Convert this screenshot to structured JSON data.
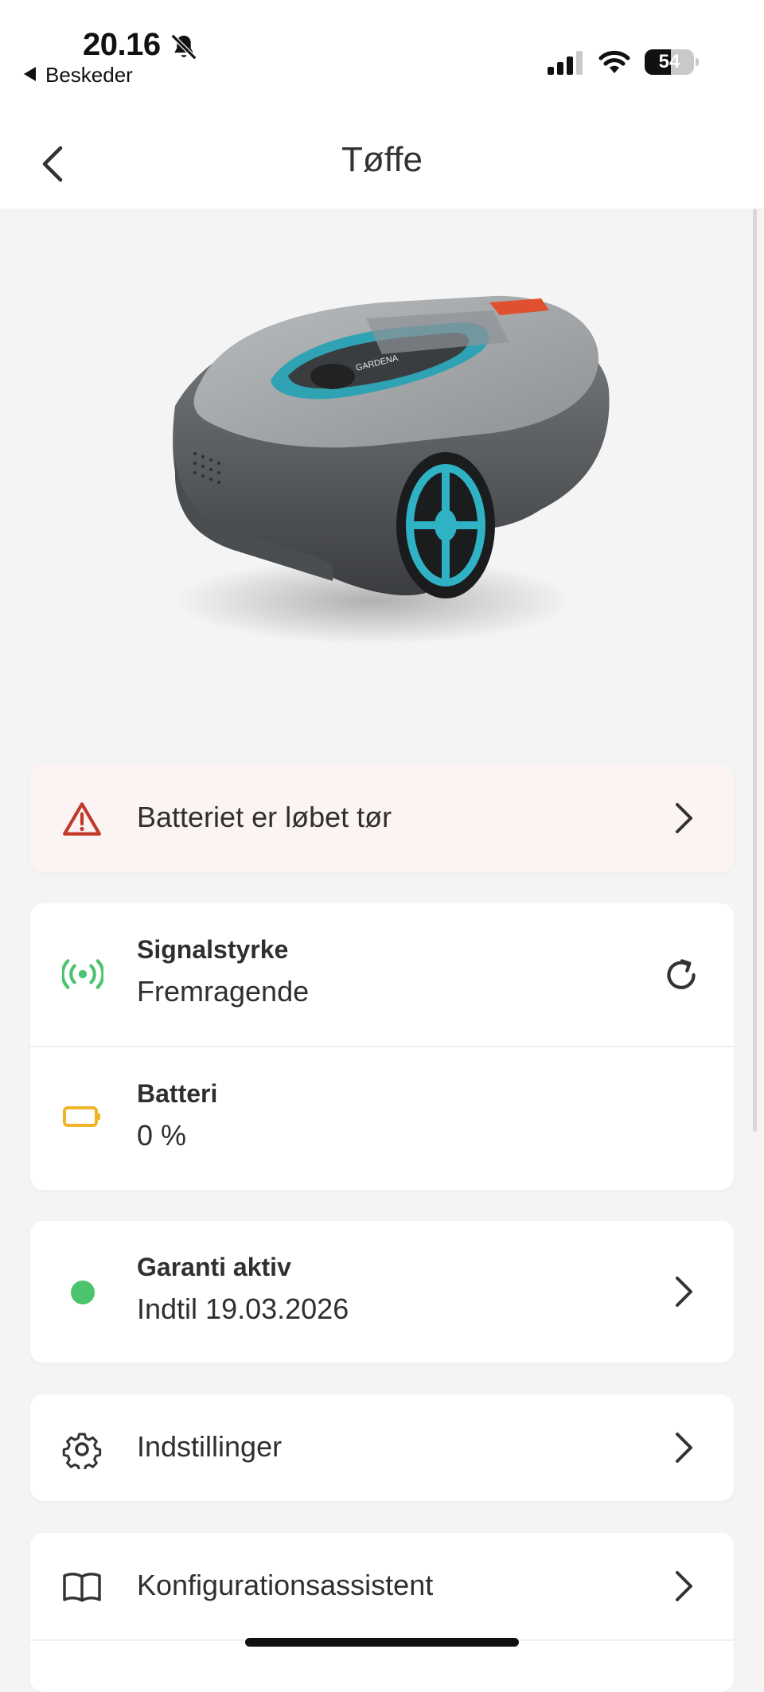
{
  "status_bar": {
    "time": "20.16",
    "back_app": "Beskeder",
    "battery_pct": "54",
    "battery_level": 0.54
  },
  "nav": {
    "title": "Tøffe"
  },
  "device": {
    "model_text": "GARDENA"
  },
  "alert": {
    "label": "Batteriet er løbet tør",
    "color": "#c0392b",
    "bg": "#fcf4f2"
  },
  "signal": {
    "title": "Signalstyrke",
    "value": "Fremragende",
    "icon_color": "#4cc36d"
  },
  "battery": {
    "title": "Batteri",
    "value": "0 %",
    "icon_color": "#f0b429"
  },
  "warranty": {
    "title": "Garanti aktiv",
    "value": "Indtil 19.03.2026",
    "dot_color": "#4cc36d"
  },
  "menu": {
    "settings_label": "Indstillinger",
    "config_label": "Konfigurationsassistent"
  },
  "icons": {
    "back": "chevron-left-icon",
    "alert": "warning-triangle-icon",
    "signal": "signal-broadcast-icon",
    "refresh": "refresh-icon",
    "battery": "battery-empty-icon",
    "settings": "gear-icon",
    "config": "book-icon",
    "chevron": "chevron-right-icon"
  }
}
